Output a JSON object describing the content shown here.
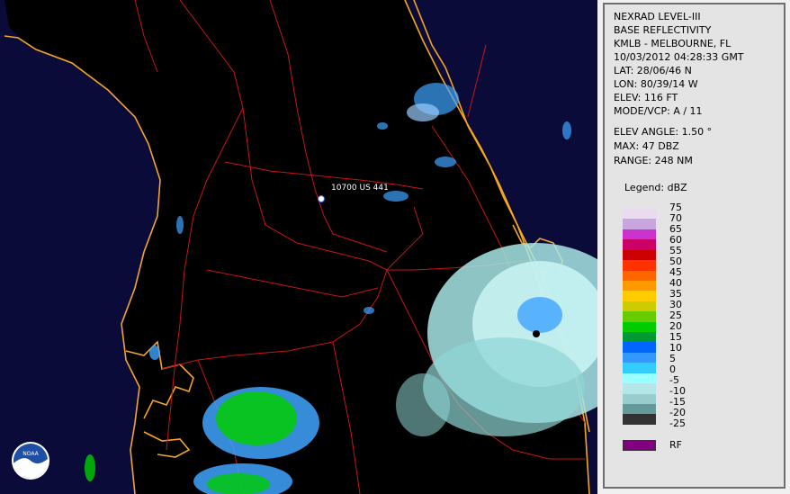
{
  "map": {
    "location_label": "10700 US 441",
    "logo_text": "NOAA"
  },
  "panel": {
    "lines": [
      "NEXRAD LEVEL-III",
      "BASE REFLECTIVITY",
      "KMLB - MELBOURNE, FL",
      "10/03/2012 04:28:33 GMT",
      "LAT: 28/06/46 N",
      "LON: 80/39/14 W",
      "ELEV: 116 FT",
      "MODE/VCP: A / 11"
    ],
    "lines2": [
      "ELEV ANGLE: 1.50 °",
      "MAX: 47 DBZ",
      "RANGE: 248 NM"
    ],
    "legend_title": "Legend: dBZ",
    "legend": [
      {
        "label": "75",
        "color": "#e9dcf0"
      },
      {
        "label": "70",
        "color": "#c9a6dd"
      },
      {
        "label": "65",
        "color": "#cc33cc"
      },
      {
        "label": "60",
        "color": "#cc0066"
      },
      {
        "label": "55",
        "color": "#cc0000"
      },
      {
        "label": "50",
        "color": "#ff3300"
      },
      {
        "label": "45",
        "color": "#ff6600"
      },
      {
        "label": "40",
        "color": "#ff9900"
      },
      {
        "label": "35",
        "color": "#ffcc00"
      },
      {
        "label": "30",
        "color": "#cccc00"
      },
      {
        "label": "25",
        "color": "#66cc00"
      },
      {
        "label": "20",
        "color": "#00cc00"
      },
      {
        "label": "15",
        "color": "#009933"
      },
      {
        "label": "10",
        "color": "#0066ff"
      },
      {
        "label": "5",
        "color": "#3399ff"
      },
      {
        "label": "0",
        "color": "#33ccff"
      },
      {
        "label": "-5",
        "color": "#99ffff"
      },
      {
        "label": "-10",
        "color": "#b3e6e6"
      },
      {
        "label": "-15",
        "color": "#99cccc"
      },
      {
        "label": "-20",
        "color": "#669999"
      },
      {
        "label": "-25",
        "color": "#333333"
      }
    ],
    "rf_label": "RF",
    "rf_color": "#800080"
  }
}
